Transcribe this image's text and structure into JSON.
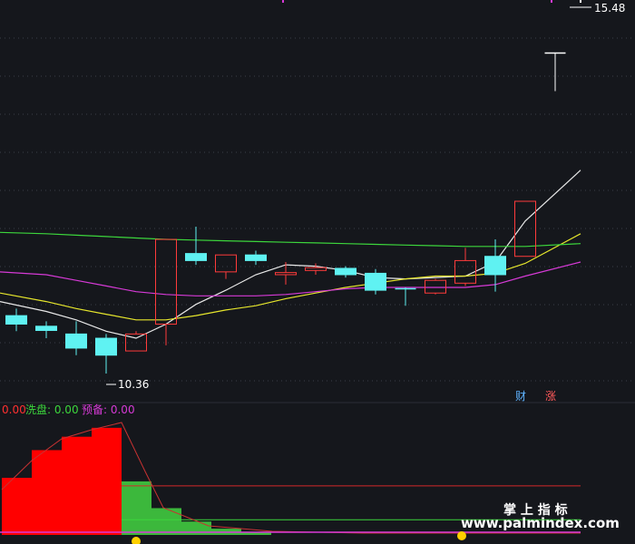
{
  "chart_data": [
    {
      "type": "candlestick",
      "title": "",
      "max_label": "15.48",
      "min_label": "10.36",
      "ylim": [
        10.0,
        15.6
      ],
      "markers": [
        {
          "text": "财",
          "color": "#5fb3ff"
        },
        {
          "text": "涨",
          "color": "#ff5a5a"
        }
      ],
      "candles": [
        {
          "o": 11.18,
          "c": 11.06,
          "h": 11.28,
          "l": 10.96
        },
        {
          "o": 11.03,
          "c": 10.97,
          "h": 11.1,
          "l": 10.86
        },
        {
          "o": 10.92,
          "c": 10.72,
          "h": 11.1,
          "l": 10.62
        },
        {
          "o": 10.86,
          "c": 10.62,
          "h": 10.92,
          "l": 10.36
        },
        {
          "o": 10.68,
          "c": 10.92,
          "h": 10.96,
          "l": 10.68
        },
        {
          "o": 11.06,
          "c": 12.26,
          "h": 12.26,
          "l": 10.76
        },
        {
          "o": 12.06,
          "c": 11.96,
          "h": 12.44,
          "l": 11.9
        },
        {
          "o": 11.8,
          "c": 12.04,
          "h": 12.04,
          "l": 11.7
        },
        {
          "o": 12.04,
          "c": 11.96,
          "h": 12.1,
          "l": 11.9
        },
        {
          "o": 11.76,
          "c": 11.79,
          "h": 11.94,
          "l": 11.62
        },
        {
          "o": 11.82,
          "c": 11.86,
          "h": 11.92,
          "l": 11.76
        },
        {
          "o": 11.85,
          "c": 11.76,
          "h": 11.88,
          "l": 11.72
        },
        {
          "o": 11.78,
          "c": 11.54,
          "h": 11.84,
          "l": 11.48
        },
        {
          "o": 11.56,
          "c": 11.56,
          "h": 11.58,
          "l": 11.32
        },
        {
          "o": 11.5,
          "c": 11.68,
          "h": 11.7,
          "l": 11.48
        },
        {
          "o": 11.64,
          "c": 11.96,
          "h": 12.14,
          "l": 11.6
        },
        {
          "o": 12.02,
          "c": 11.76,
          "h": 12.26,
          "l": 11.52
        },
        {
          "o": 12.02,
          "c": 12.8,
          "h": 12.8,
          "l": 12.02
        },
        {
          "o": 14.9,
          "c": 14.9,
          "h": 14.9,
          "l": 14.36
        }
      ],
      "series": [
        {
          "color": "#e8e8e8",
          "values": [
            11.38,
            11.24,
            11.12,
            10.96,
            10.86,
            11.06,
            11.34,
            11.54,
            11.76,
            11.9,
            11.88,
            11.82,
            11.72,
            11.7,
            11.72,
            11.74,
            11.94,
            12.52,
            13.24
          ]
        },
        {
          "color": "#e6e62c",
          "values": [
            11.5,
            11.38,
            11.28,
            11.2,
            11.12,
            11.12,
            11.18,
            11.26,
            11.32,
            11.42,
            11.5,
            11.58,
            11.64,
            11.7,
            11.74,
            11.74,
            11.78,
            11.92,
            12.34
          ]
        },
        {
          "color": "#d63ad6",
          "values": [
            11.8,
            11.76,
            11.68,
            11.6,
            11.52,
            11.48,
            11.46,
            11.46,
            11.46,
            11.48,
            11.52,
            11.56,
            11.58,
            11.58,
            11.58,
            11.58,
            11.62,
            11.74,
            11.94
          ]
        },
        {
          "color": "#3cd63c",
          "values": [
            12.36,
            12.34,
            12.32,
            12.3,
            12.28,
            12.26,
            12.25,
            12.24,
            12.23,
            12.22,
            12.21,
            12.2,
            12.19,
            12.18,
            12.17,
            12.16,
            12.16,
            12.16,
            12.2
          ]
        }
      ]
    },
    {
      "type": "bar",
      "title": "",
      "legend": [
        {
          "name": "洗盘",
          "label": "洗盘: 0.00",
          "color": "#3cd63c"
        },
        {
          "name": "预备",
          "label": "预备: 0.00",
          "color": "#d63ad6"
        }
      ],
      "first_value_label": "0.00",
      "ylim": [
        0,
        130
      ],
      "red_values": [
        64,
        95,
        110,
        120,
        0,
        0,
        0,
        0,
        0
      ],
      "green_values": [
        0,
        0,
        0,
        0,
        60,
        30,
        15,
        7,
        3
      ],
      "ref_levels": [
        {
          "value": 55,
          "color": "#d42a2a"
        },
        {
          "value": 17,
          "color": "#3cd63c"
        }
      ]
    }
  ],
  "watermark": {
    "line1": "掌 上 指 标",
    "line2": "www.palmindex.com"
  }
}
